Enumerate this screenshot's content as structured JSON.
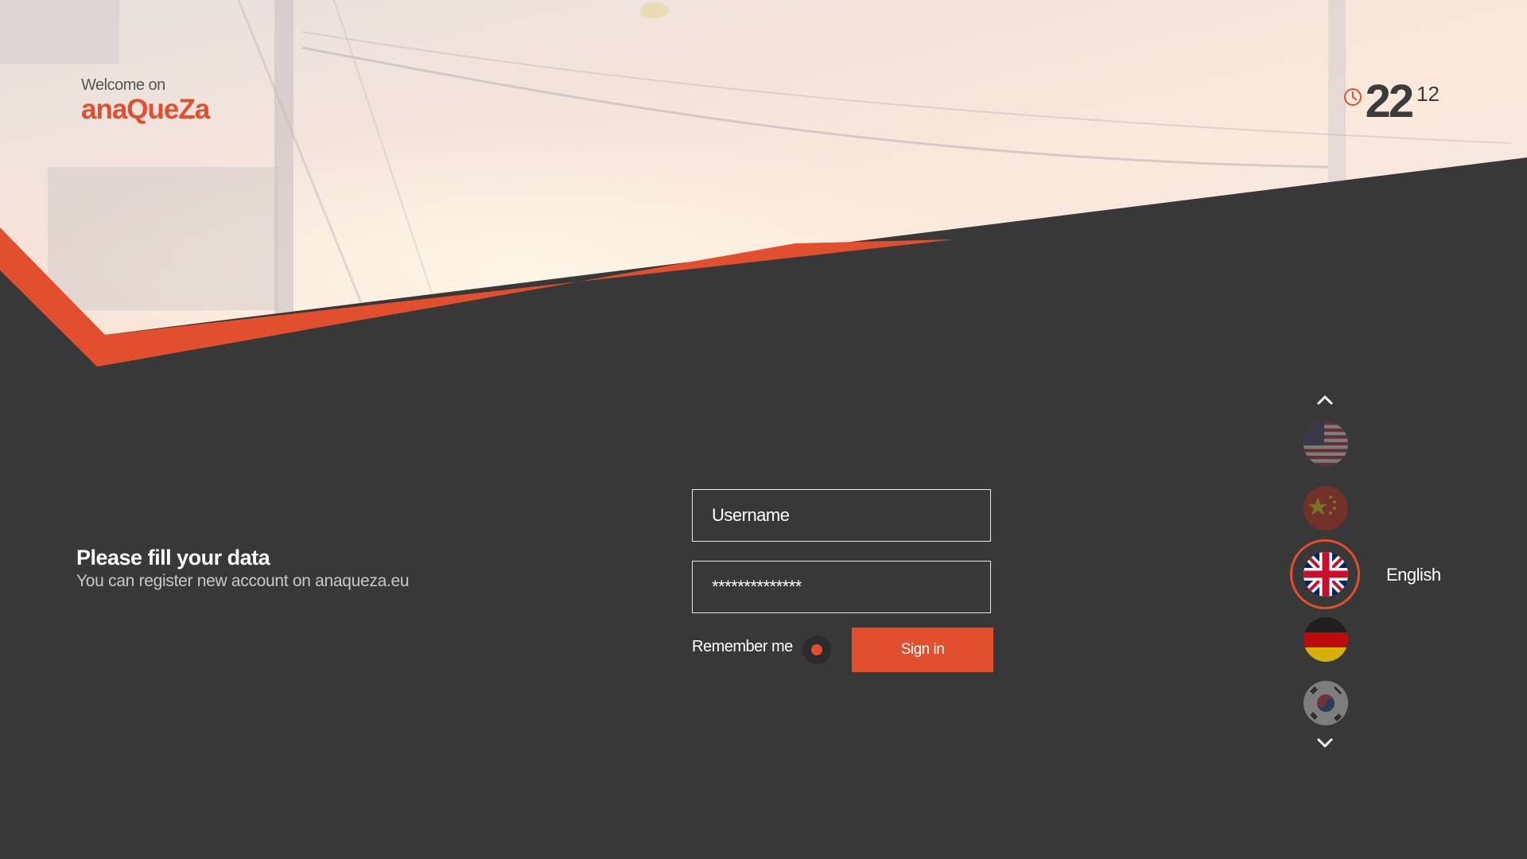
{
  "header": {
    "welcome_text": "Welcome on",
    "brand_name": "anaQueZa",
    "brand_color": "#e14f2f"
  },
  "clock": {
    "icon": "clock-icon",
    "hours": "22",
    "minutes": "12"
  },
  "info": {
    "title": "Please fill your data",
    "subtitle": "You can register new account on anaqueza.eu"
  },
  "login_form": {
    "username_placeholder": "Username",
    "username_value": "",
    "password_value": "**************",
    "remember_label": "Remember me",
    "remember_checked": true,
    "signin_label": "Sign in"
  },
  "language_picker": {
    "scroll_up_icon": "chevron-up-icon",
    "scroll_down_icon": "chevron-down-icon",
    "flags": [
      "flag-usa-icon",
      "flag-china-icon",
      "flag-uk-icon",
      "flag-germany-icon",
      "flag-south-korea-icon"
    ],
    "selected_label": "English"
  },
  "colors": {
    "accent": "#e14f2f",
    "background": "#383838"
  }
}
